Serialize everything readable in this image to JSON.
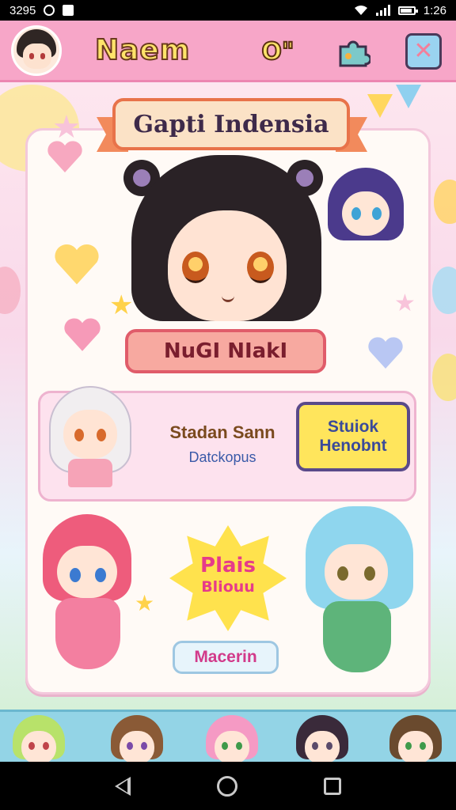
{
  "status_bar": {
    "left_text": "3295",
    "time": "1:26",
    "icons": [
      "circle-icon",
      "square-icon",
      "wifi-icon",
      "signal-icon",
      "battery-icon"
    ]
  },
  "header": {
    "title": "Naem",
    "search_label": "O\"",
    "icons": [
      "avatar",
      "search-icon",
      "puzzle-icon",
      "close-icon"
    ]
  },
  "banner": {
    "title": "Gapti Indensia"
  },
  "featured": {
    "character_button": "NuGI NIakI"
  },
  "info_panel": {
    "title": "Stadan Sann",
    "subtitle": "Datckopus",
    "studio_button_line1": "Stuiok",
    "studio_button_line2": "Henobnt"
  },
  "promo": {
    "burst_line1": "Plais",
    "burst_line2": "Bliouu",
    "more_button": "Macerin"
  },
  "colors": {
    "header_bg": "#f7a6c8",
    "title_fill": "#ffe36a",
    "banner_border": "#e8734a",
    "studio_button_bg": "#ffe55c",
    "burst_bg": "#ffe24d",
    "strip_bg": "#93d4e6"
  },
  "nav_bar": {
    "icons": [
      "back-icon",
      "home-icon",
      "recents-icon"
    ]
  }
}
